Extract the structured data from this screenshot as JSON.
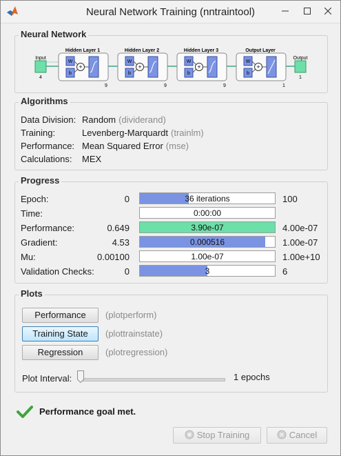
{
  "window": {
    "title": "Neural Network Training (nntraintool)",
    "min_icon": "minimize-icon",
    "max_icon": "maximize-icon",
    "close_icon": "close-icon"
  },
  "network": {
    "section_title": "Neural Network",
    "input_label": "Input",
    "input_size": "4",
    "layers": [
      {
        "label": "Hidden Layer 1",
        "size": "9",
        "transfer": "tansig"
      },
      {
        "label": "Hidden Layer 2",
        "size": "9",
        "transfer": "tansig"
      },
      {
        "label": "Hidden Layer 3",
        "size": "9",
        "transfer": "tansig"
      },
      {
        "label": "Output Layer",
        "size": "1",
        "transfer": "purelin"
      }
    ],
    "weight_label": "W",
    "bias_label": "b",
    "sum_label": "+",
    "output_label": "Output",
    "output_size": "1"
  },
  "algorithms": {
    "section_title": "Algorithms",
    "rows": [
      {
        "label": "Data Division:",
        "value": "Random",
        "fn": "(dividerand)"
      },
      {
        "label": "Training:",
        "value": "Levenberg-Marquardt",
        "fn": "(trainlm)"
      },
      {
        "label": "Performance:",
        "value": "Mean Squared Error",
        "fn": "(mse)"
      },
      {
        "label": "Calculations:",
        "value": "MEX",
        "fn": ""
      }
    ]
  },
  "progress": {
    "section_title": "Progress",
    "rows": [
      {
        "label": "Epoch:",
        "start": "0",
        "bar_text": "36 iterations",
        "end": "100",
        "fill": 0.36,
        "color": "#7b93e3"
      },
      {
        "label": "Time:",
        "start": "",
        "bar_text": "0:00:00",
        "end": "",
        "fill": 0,
        "color": "#7b93e3"
      },
      {
        "label": "Performance:",
        "start": "0.649",
        "bar_text": "3.90e-07",
        "end": "4.00e-07",
        "fill": 1.0,
        "color": "#6ddfa8"
      },
      {
        "label": "Gradient:",
        "start": "4.53",
        "bar_text": "0.000516",
        "end": "1.00e-07",
        "fill": 0.93,
        "color": "#7b93e3"
      },
      {
        "label": "Mu:",
        "start": "0.00100",
        "bar_text": "1.00e-07",
        "end": "1.00e+10",
        "fill": 0.0,
        "color": "#7b93e3"
      },
      {
        "label": "Validation Checks:",
        "start": "0",
        "bar_text": "3",
        "end": "6",
        "fill": 0.5,
        "color": "#7b93e3"
      }
    ]
  },
  "plots": {
    "section_title": "Plots",
    "buttons": [
      {
        "label": "Performance",
        "fn": "(plotperform)",
        "active": false
      },
      {
        "label": "Training State",
        "fn": "(plottrainstate)",
        "active": true
      },
      {
        "label": "Regression",
        "fn": "(plotregression)",
        "active": false
      }
    ],
    "interval_label": "Plot Interval:",
    "interval_value": 1,
    "interval_text": "1 epochs"
  },
  "status": {
    "icon": "checkmark-icon",
    "text": "Performance goal met.",
    "color": "#3aa53a"
  },
  "footer": {
    "stop_label": "Stop Training",
    "cancel_label": "Cancel",
    "stop_icon": "stop-icon",
    "cancel_icon": "cancel-icon"
  }
}
